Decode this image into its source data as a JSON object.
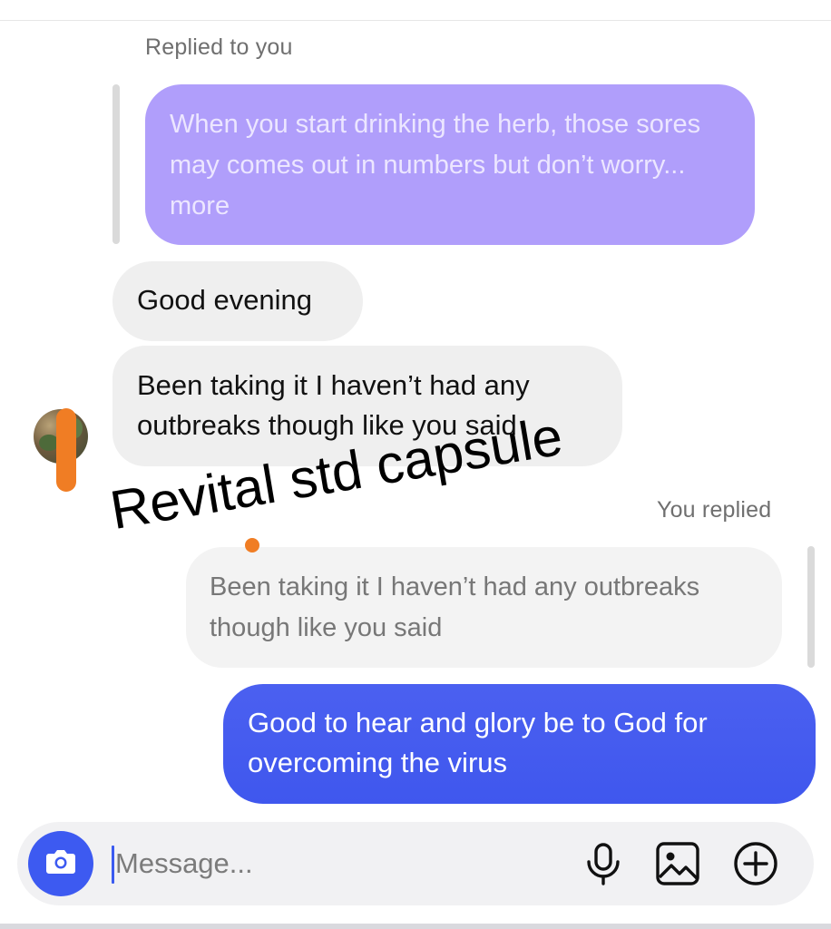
{
  "thread": {
    "replied_to_you_label": "Replied to you",
    "quoted_incoming_text": "When you start drinking the herb, those sores may comes out in numbers but don’t worry... more",
    "incoming_messages": [
      "Good evening",
      "Been taking it I haven’t had any outbreaks though like you said"
    ],
    "you_replied_label": "You replied",
    "quoted_own_reply_text": "Been taking it I haven’t had any outbreaks though like you said",
    "outgoing_message": "Good to hear and glory be to God for overcoming the virus"
  },
  "overlay": {
    "caption": "Revital std capsule"
  },
  "composer": {
    "placeholder": "Message...",
    "icons": [
      "camera-icon",
      "microphone-icon",
      "gallery-icon",
      "plus-circle-icon"
    ]
  },
  "colors": {
    "outgoing_bubble": "#3f57ee",
    "quoted_purple": "#b09efb",
    "incoming_bubble": "#efefef",
    "camera_button": "#3d5af1",
    "redaction_mark": "#f07d24"
  }
}
